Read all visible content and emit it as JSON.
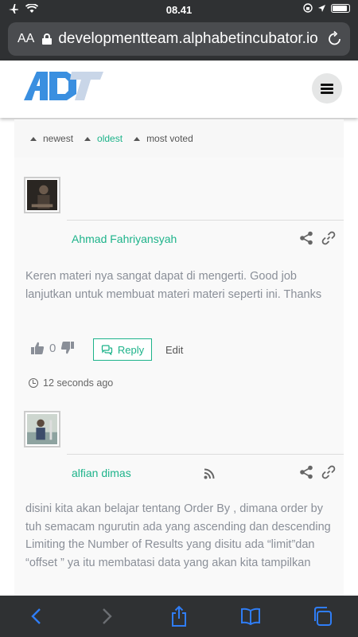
{
  "status": {
    "time": "08.41"
  },
  "browser": {
    "aa_label": "AA",
    "url": "developmentteam.alphabetincubator.io"
  },
  "sort": {
    "items": [
      "newest",
      "oldest",
      "most voted"
    ],
    "active": "oldest"
  },
  "comments": [
    {
      "author": "Ahmad Fahriyansyah",
      "text": "Keren materi nya sangat dapat di mengerti. Good job lanjutkan untuk membuat materi materi seperti ini. Thanks",
      "votes": "0",
      "reply_label": "Reply",
      "edit_label": "Edit",
      "time": "12 seconds ago"
    },
    {
      "author": "alfian dimas",
      "text_lines": [
        "disini kita akan belajar tentang Order By , dimana order by tuh semacam ngurutin ada yang ascending dan descending",
        "Limiting the Number of Results yang disitu ada “limit”dan “offset ” ya itu membatasi data yang akan kita tampilkan"
      ]
    }
  ],
  "colors": {
    "accent": "#1db38a",
    "browser_chrome": "#2f3133",
    "ios_blue": "#2f7df6"
  }
}
